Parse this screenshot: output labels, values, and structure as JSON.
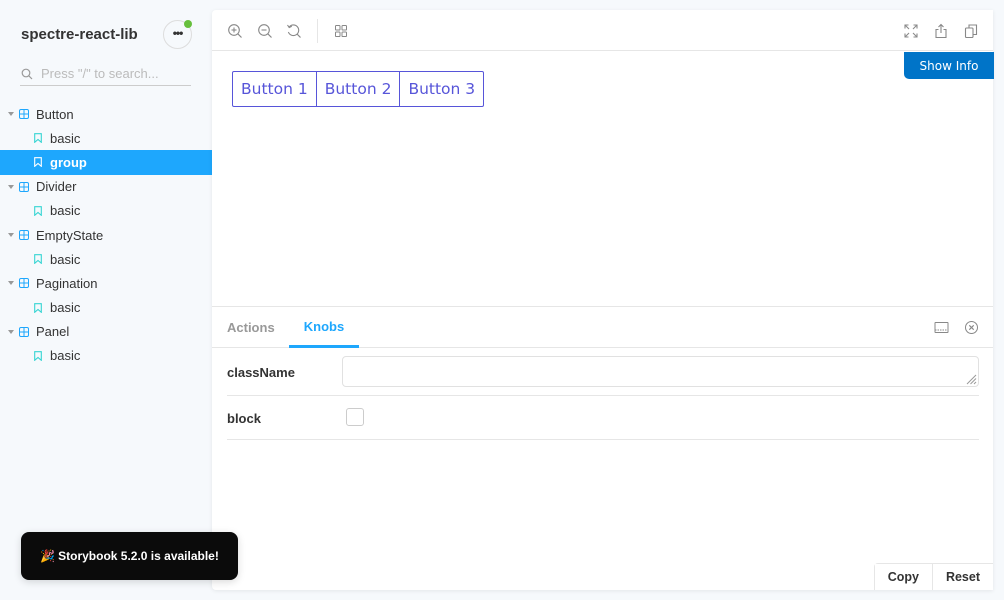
{
  "sidebar": {
    "title": "spectre-react-lib",
    "menu_icon": "ellipsis-icon",
    "menu_badge_color": "#66bf3c",
    "search": {
      "placeholder": "Press \"/\" to search...",
      "value": "",
      "icon": "search-icon"
    },
    "tree": [
      {
        "type": "component",
        "label": "Button",
        "icon": "component-grid-icon",
        "expanded": true
      },
      {
        "type": "story",
        "label": "basic",
        "icon": "bookmark-icon",
        "selected": false
      },
      {
        "type": "story",
        "label": "group",
        "icon": "bookmark-icon",
        "selected": true
      },
      {
        "type": "component",
        "label": "Divider",
        "icon": "component-grid-icon",
        "expanded": true
      },
      {
        "type": "story",
        "label": "basic",
        "icon": "bookmark-icon",
        "selected": false
      },
      {
        "type": "component",
        "label": "EmptyState",
        "icon": "component-grid-icon",
        "expanded": true
      },
      {
        "type": "story",
        "label": "basic",
        "icon": "bookmark-icon",
        "selected": false
      },
      {
        "type": "component",
        "label": "Pagination",
        "icon": "component-grid-icon",
        "expanded": true
      },
      {
        "type": "story",
        "label": "basic",
        "icon": "bookmark-icon",
        "selected": false
      },
      {
        "type": "component",
        "label": "Panel",
        "icon": "component-grid-icon",
        "expanded": true
      },
      {
        "type": "story",
        "label": "basic",
        "icon": "bookmark-icon",
        "selected": false
      }
    ]
  },
  "toolbar": {
    "left_icons": [
      "zoom-in-icon",
      "zoom-out-icon",
      "zoom-reset-icon",
      "grid-icon"
    ],
    "right_icons": [
      "fullscreen-icon",
      "share-icon",
      "copy-icon"
    ]
  },
  "preview": {
    "show_info_label": "Show Info",
    "button_group": [
      "Button 1",
      "Button 2",
      "Button 3"
    ]
  },
  "addons": {
    "tabs": [
      {
        "label": "Actions",
        "active": false
      },
      {
        "label": "Knobs",
        "active": true
      }
    ],
    "icons": [
      "panel-bottom-icon",
      "close-circle-icon"
    ],
    "knobs": [
      {
        "label": "className",
        "type": "text",
        "value": ""
      },
      {
        "label": "block",
        "type": "boolean",
        "value": false
      }
    ],
    "copy_label": "Copy",
    "reset_label": "Reset"
  },
  "notification": {
    "emoji": "🎉",
    "text": "Storybook 5.2.0 is available!"
  },
  "colors": {
    "accent": "#1ea7fd",
    "show_info_bg": "#0074c8",
    "button_group": "#5755d9"
  }
}
